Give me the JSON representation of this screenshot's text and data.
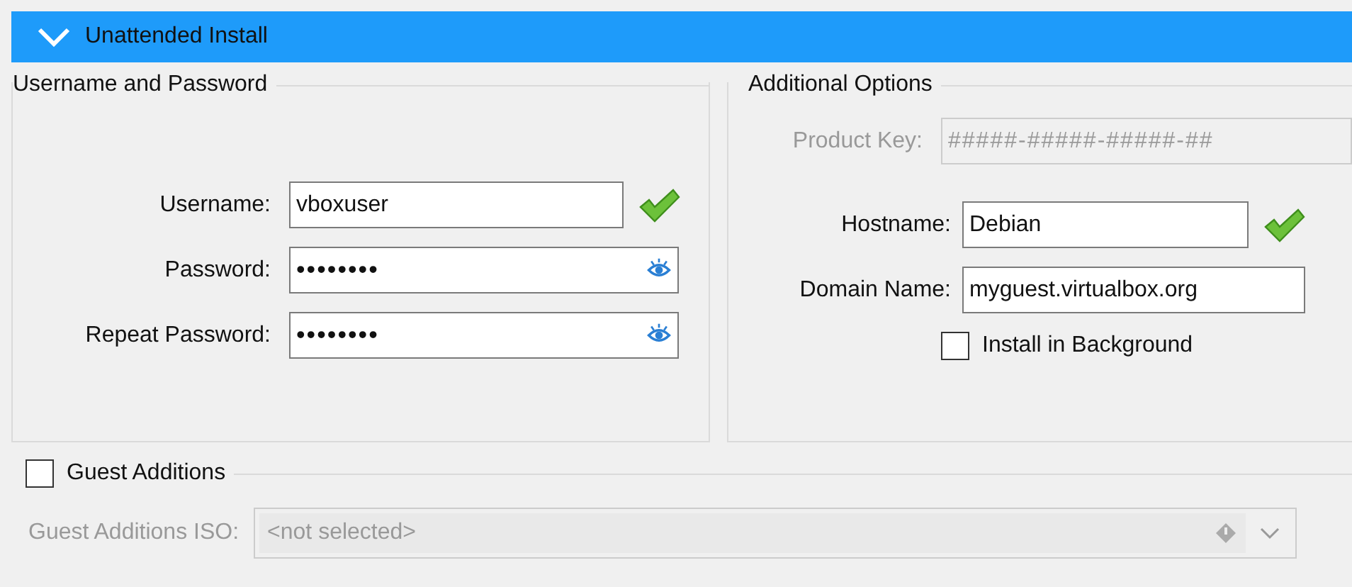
{
  "header": {
    "title": "Unattended Install",
    "expanded": true
  },
  "credentials": {
    "title": "Username and Password",
    "fields": [
      {
        "label": "Username:",
        "value": "vboxuser",
        "kind": "text",
        "valid": true
      },
      {
        "label": "Password:",
        "value": "••••••••",
        "kind": "password",
        "valid": false
      },
      {
        "label": "Repeat Password:",
        "value": "••••••••",
        "kind": "password",
        "valid": false
      }
    ]
  },
  "additional_options": {
    "title": "Additional Options",
    "fields": [
      {
        "label": "Product Key:",
        "placeholder": "#####-#####-#####-##",
        "kind": "key",
        "disabled": true,
        "valid": false
      },
      {
        "label": "Hostname:",
        "value": "Debian",
        "kind": "host",
        "disabled": false,
        "valid": true
      },
      {
        "label": "Domain Name:",
        "value": "myguest.virtualbox.org",
        "kind": "domain",
        "disabled": false,
        "valid": false
      }
    ],
    "install_in_background": {
      "label": "Install in Background",
      "checked": false
    }
  },
  "guest_additions": {
    "label": "Guest Additions",
    "checked": false,
    "iso": {
      "label": "Guest Additions ISO:",
      "value": "<not selected>",
      "disabled": true
    }
  }
}
